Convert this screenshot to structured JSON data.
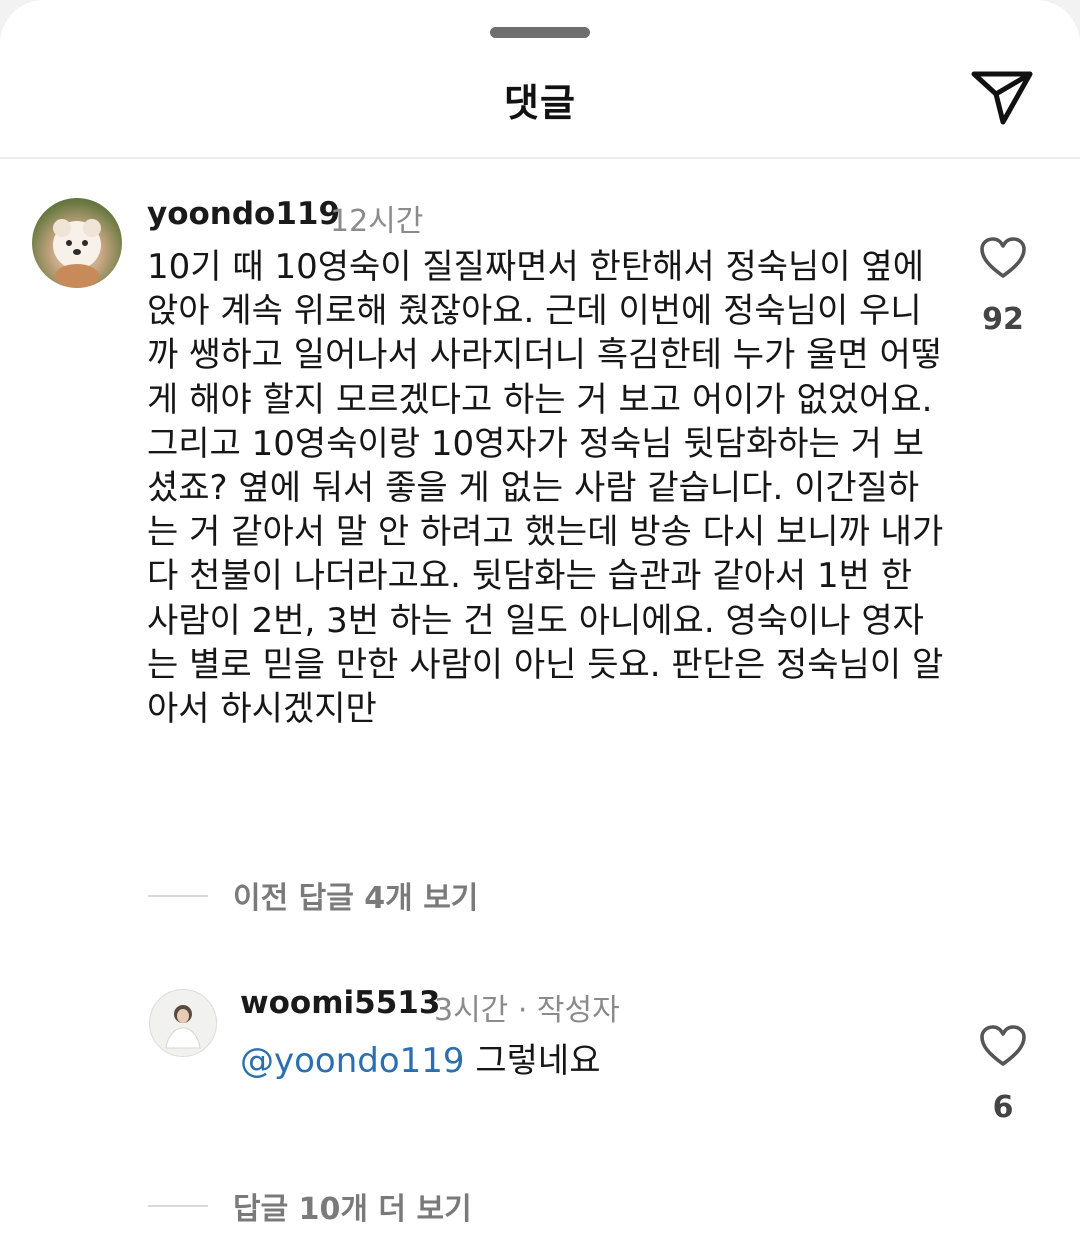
{
  "header": {
    "title": "댓글",
    "share_icon": "paper-plane-icon"
  },
  "comment": {
    "username": "yoondo119",
    "time": "12시간",
    "text": "10기 때 10영숙이 질질짜면서 한탄해서 정숙님이 옆에 앉아 계속 위로해 줬잖아요. 근데 이번에 정숙님이 우니까 쌩하고 일어나서 사라지더니 흑김한테 누가 울면 어떻게 해야 할지 모르겠다고 하는 거 보고 어이가 없었어요. 그리고 10영숙이랑 10영자가 정숙님 뒷담화하는 거 보셨죠? 옆에 둬서 좋을 게 없는 사람 같습니다. 이간질하는 거 같아서 말 안 하려고 했는데 방송 다시 보니까 내가 다 천불이 나더라고요. 뒷담화는 습관과 같아서 1번 한 사람이 2번, 3번 하는 건 일도 아니에요. 영숙이나 영자는 별로 믿을 만한 사람이 아닌 듯요. 판단은 정숙님이 알아서 하시겠지만",
    "likes": "92"
  },
  "view_previous_replies": "이전 답글 4개 보기",
  "reply": {
    "username": "woomi5513",
    "meta": "3시간 · 작성자",
    "mention": "@yoondo119",
    "text": "그렇네요",
    "likes": "6"
  },
  "view_more_replies": "답글 10개 더 보기",
  "colors": {
    "mention": "#2a6fb0",
    "muted": "#8b8b8b",
    "background": "#ffffff"
  }
}
